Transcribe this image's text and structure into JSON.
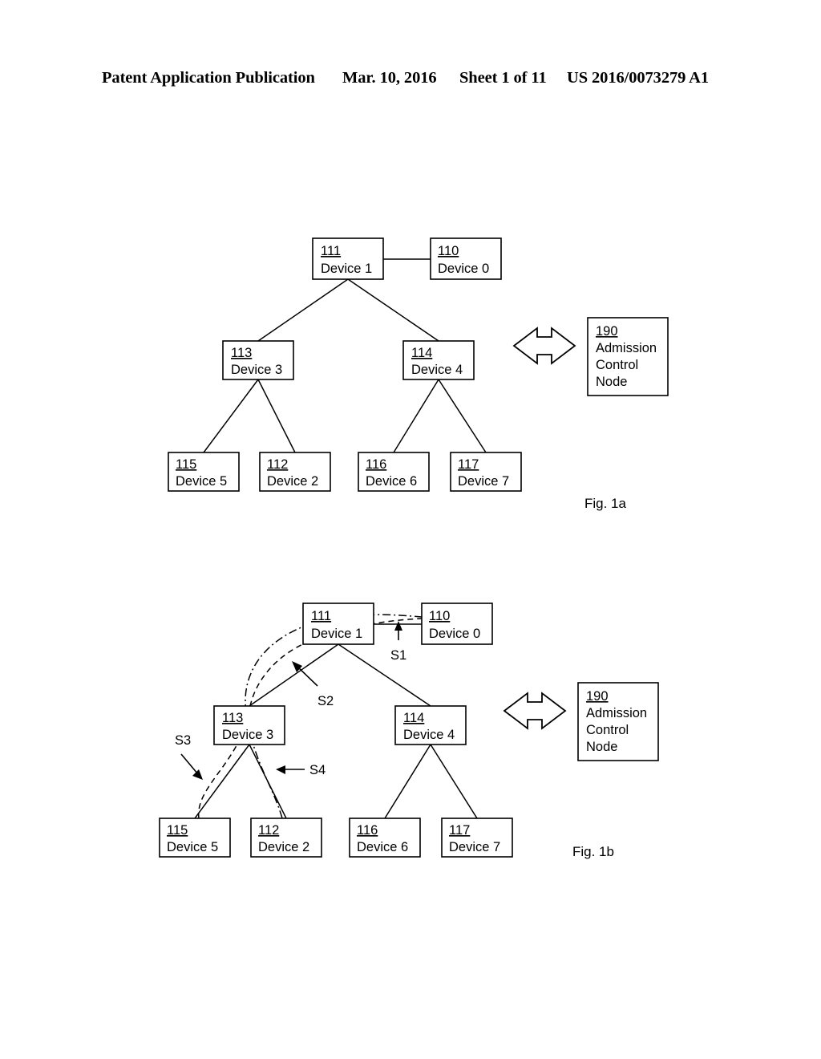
{
  "header": {
    "publication": "Patent Application Publication",
    "date": "Mar. 10, 2016",
    "sheet": "Sheet 1 of 11",
    "patent_number": "US 2016/0073279 A1"
  },
  "figures": [
    {
      "caption": "Fig. 1a",
      "nodes": [
        {
          "ref": "111",
          "label": "Device 1"
        },
        {
          "ref": "110",
          "label": "Device 0"
        },
        {
          "ref": "113",
          "label": "Device 3"
        },
        {
          "ref": "114",
          "label": "Device 4"
        },
        {
          "ref": "115",
          "label": "Device 5"
        },
        {
          "ref": "112",
          "label": "Device 2"
        },
        {
          "ref": "116",
          "label": "Device 6"
        },
        {
          "ref": "117",
          "label": "Device 7"
        }
      ],
      "admission_node": {
        "ref": "190",
        "line1": "Admission",
        "line2": "Control",
        "line3": "Node"
      },
      "signals": []
    },
    {
      "caption": "Fig. 1b",
      "nodes": [
        {
          "ref": "111",
          "label": "Device 1"
        },
        {
          "ref": "110",
          "label": "Device 0"
        },
        {
          "ref": "113",
          "label": "Device 3"
        },
        {
          "ref": "114",
          "label": "Device 4"
        },
        {
          "ref": "115",
          "label": "Device 5"
        },
        {
          "ref": "112",
          "label": "Device 2"
        },
        {
          "ref": "116",
          "label": "Device 6"
        },
        {
          "ref": "117",
          "label": "Device 7"
        }
      ],
      "admission_node": {
        "ref": "190",
        "line1": "Admission",
        "line2": "Control",
        "line3": "Node"
      },
      "signals": [
        {
          "name": "S1"
        },
        {
          "name": "S2"
        },
        {
          "name": "S3"
        },
        {
          "name": "S4"
        }
      ]
    }
  ],
  "colors": {
    "ink": "#000000",
    "paper": "#ffffff"
  }
}
